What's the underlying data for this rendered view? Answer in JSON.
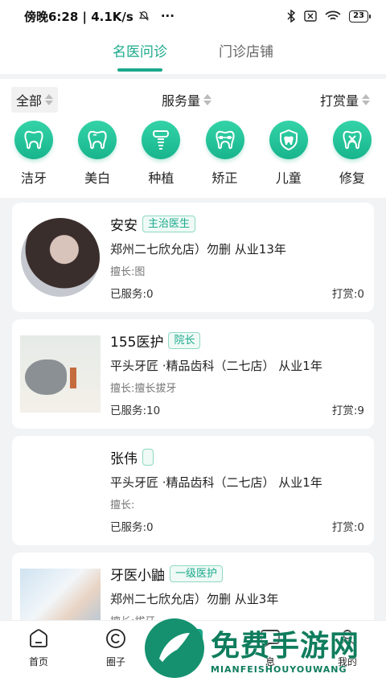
{
  "status_bar": {
    "time_speed": "傍晚6:28 | 4.1K/s",
    "more": "···",
    "battery": "23"
  },
  "tabs": [
    {
      "label": "名医问诊",
      "active": true
    },
    {
      "label": "门诊店铺",
      "active": false
    }
  ],
  "filters": {
    "all": "全部",
    "service": "服务量",
    "tip": "打赏量"
  },
  "categories": [
    {
      "label": "洁牙",
      "icon": "tooth-icon"
    },
    {
      "label": "美白",
      "icon": "tooth-whitening-icon"
    },
    {
      "label": "种植",
      "icon": "implant-icon"
    },
    {
      "label": "矫正",
      "icon": "braces-icon"
    },
    {
      "label": "儿童",
      "icon": "child-shield-icon"
    },
    {
      "label": "修复",
      "icon": "repair-icon"
    }
  ],
  "doctors": [
    {
      "name": "安安",
      "title": "主治医生",
      "hospital": "郑州二七欣允店）勿删   从业13年",
      "specialty": "擅长:图",
      "served": "已服务:0",
      "tips": "打赏:0"
    },
    {
      "name": "155医护",
      "title": "院长",
      "hospital": "平头牙匠 ·精品齿科（二七店）   从业1年",
      "specialty": "擅长:擅长拔牙",
      "served": "已服务:10",
      "tips": "打赏:9"
    },
    {
      "name": "张伟",
      "title": "",
      "hospital": "平头牙匠 ·精品齿科（二七店）   从业1年",
      "specialty": "擅长:",
      "served": "已服务:0",
      "tips": "打赏:0"
    },
    {
      "name": "牙医小鼬",
      "title": "一级医护",
      "hospital": "郑州二七欣允店）勿删   从业3年",
      "specialty": "擅长:拔牙",
      "served": "",
      "tips": ""
    }
  ],
  "bottom_nav": [
    {
      "label": "首页",
      "icon": "home-icon"
    },
    {
      "label": "圈子",
      "icon": "circle-icon"
    },
    {
      "label": "",
      "icon": "center-icon"
    },
    {
      "label": "息",
      "icon": "message-icon"
    },
    {
      "label": "我的",
      "icon": "profile-icon"
    }
  ],
  "watermark": {
    "title": "免费手游网",
    "subtitle": "MIANFEISHOUYOUWANG"
  },
  "colors": {
    "accent": "#1aa98b",
    "badge_border": "#8ed8c3",
    "watermark": "#0f7d5d"
  }
}
